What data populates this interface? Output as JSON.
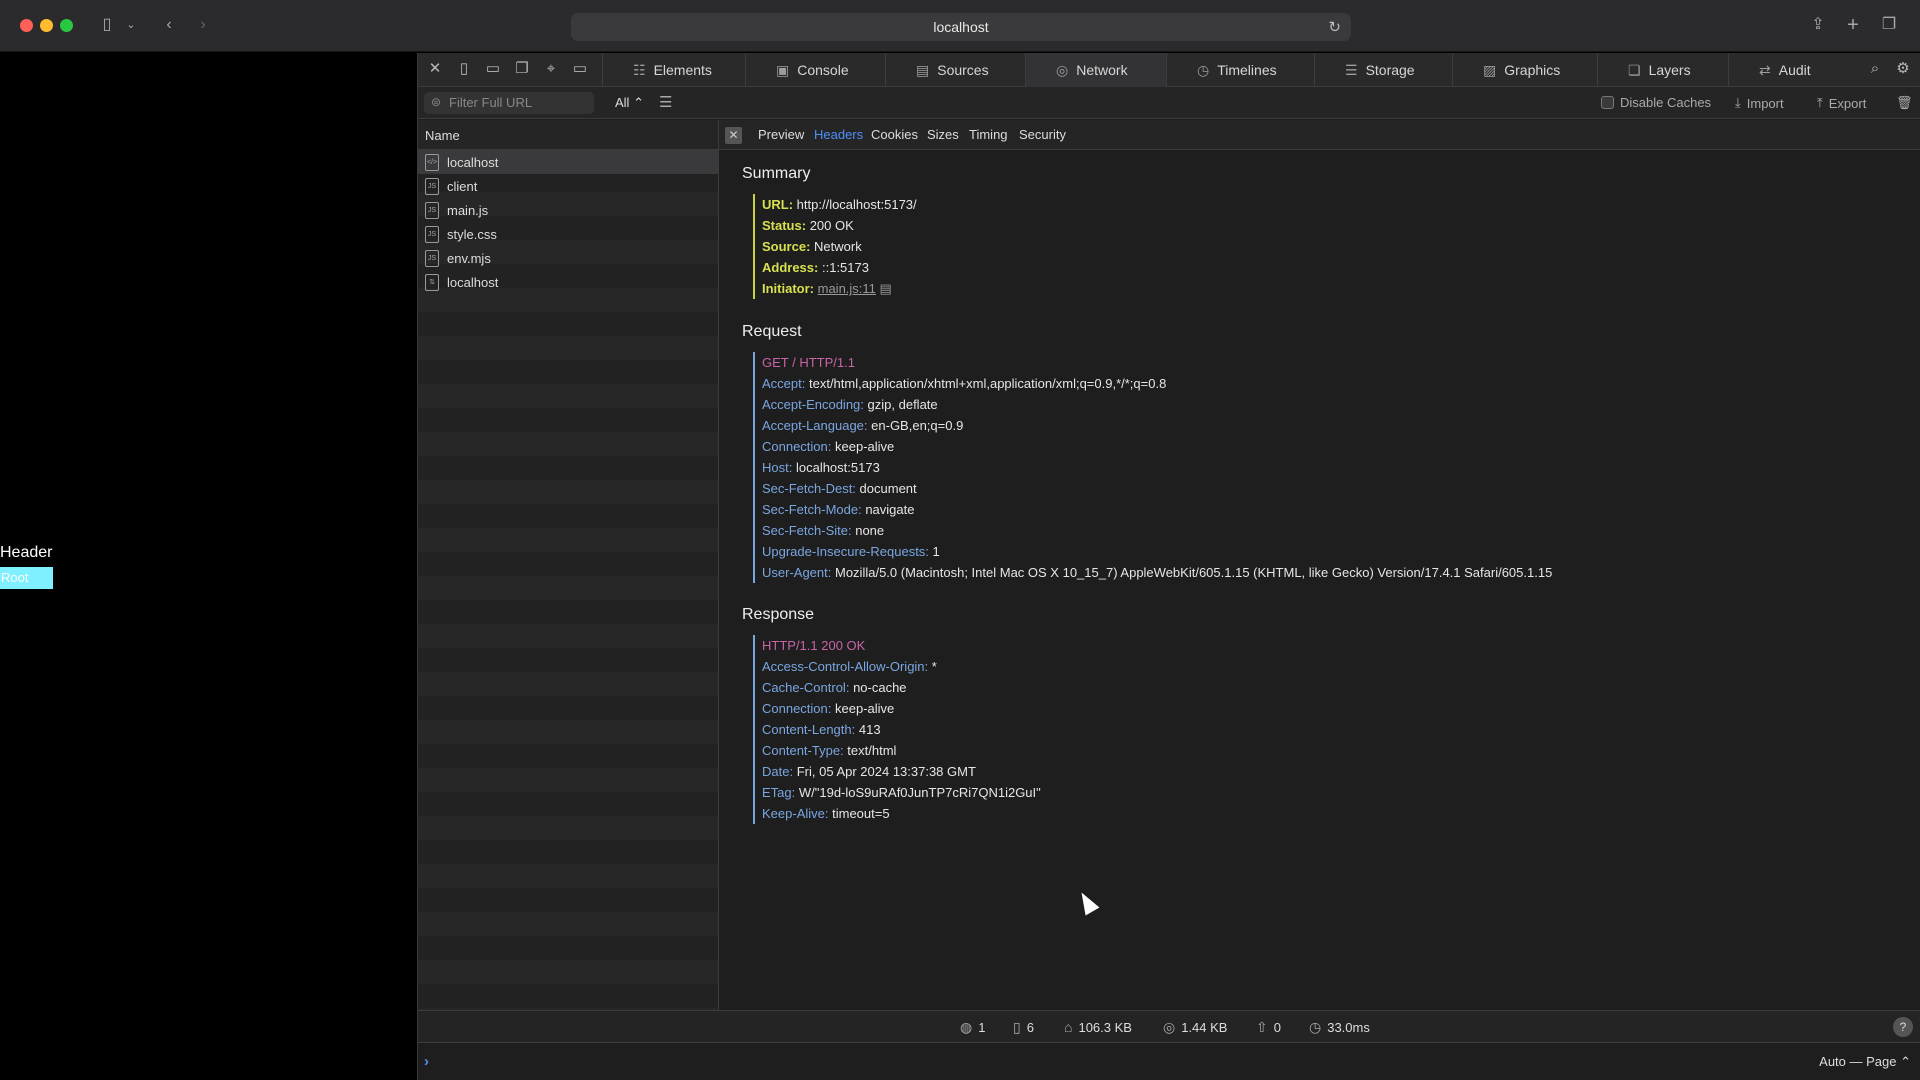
{
  "browser": {
    "url": "localhost"
  },
  "page": {
    "header_text": "Header",
    "root_text": "Root"
  },
  "devtools": {
    "tabs": [
      {
        "label": "Elements",
        "icon": "elements-icon"
      },
      {
        "label": "Console",
        "icon": "console-icon"
      },
      {
        "label": "Sources",
        "icon": "sources-icon"
      },
      {
        "label": "Network",
        "icon": "network-icon"
      },
      {
        "label": "Timelines",
        "icon": "timelines-icon"
      },
      {
        "label": "Storage",
        "icon": "storage-icon"
      },
      {
        "label": "Graphics",
        "icon": "graphics-icon"
      },
      {
        "label": "Layers",
        "icon": "layers-icon"
      },
      {
        "label": "Audit",
        "icon": "audit-icon"
      }
    ],
    "active_tab": "Network",
    "filter": {
      "placeholder": "Filter Full URL",
      "type_select": "All",
      "disable_caches": "Disable Caches",
      "import": "Import",
      "export": "Export"
    },
    "list": {
      "column_name": "Name",
      "rows": [
        {
          "name": "localhost",
          "icon": "html-file-icon"
        },
        {
          "name": "client",
          "icon": "js-file-icon"
        },
        {
          "name": "main.js",
          "icon": "js-file-icon"
        },
        {
          "name": "style.css",
          "icon": "css-file-icon"
        },
        {
          "name": "env.mjs",
          "icon": "js-file-icon"
        },
        {
          "name": "localhost",
          "icon": "websocket-file-icon"
        }
      ]
    },
    "detail_tabs": [
      "Preview",
      "Headers",
      "Cookies",
      "Sizes",
      "Timing",
      "Security"
    ],
    "active_detail_tab": "Headers",
    "summary": {
      "title": "Summary",
      "url_k": "URL:",
      "url_v": "http://localhost:5173/",
      "status_k": "Status:",
      "status_v": "200 OK",
      "source_k": "Source:",
      "source_v": "Network",
      "address_k": "Address:",
      "address_v": "::1:5173",
      "initiator_k": "Initiator:",
      "initiator_v": "main.js:11"
    },
    "request": {
      "title": "Request",
      "first_line": "GET / HTTP/1.1",
      "headers": [
        {
          "k": "Accept:",
          "v": "text/html,application/xhtml+xml,application/xml;q=0.9,*/*;q=0.8"
        },
        {
          "k": "Accept-Encoding:",
          "v": "gzip, deflate"
        },
        {
          "k": "Accept-Language:",
          "v": "en-GB,en;q=0.9"
        },
        {
          "k": "Connection:",
          "v": "keep-alive"
        },
        {
          "k": "Host:",
          "v": "localhost:5173"
        },
        {
          "k": "Sec-Fetch-Dest:",
          "v": "document"
        },
        {
          "k": "Sec-Fetch-Mode:",
          "v": "navigate"
        },
        {
          "k": "Sec-Fetch-Site:",
          "v": "none"
        },
        {
          "k": "Upgrade-Insecure-Requests:",
          "v": "1"
        },
        {
          "k": "User-Agent:",
          "v": "Mozilla/5.0 (Macintosh; Intel Mac OS X 10_15_7) AppleWebKit/605.1.15 (KHTML, like Gecko) Version/17.4.1 Safari/605.1.15"
        }
      ]
    },
    "response": {
      "title": "Response",
      "first_line": "HTTP/1.1 200 OK",
      "headers": [
        {
          "k": "Access-Control-Allow-Origin:",
          "v": "*"
        },
        {
          "k": "Cache-Control:",
          "v": "no-cache"
        },
        {
          "k": "Connection:",
          "v": "keep-alive"
        },
        {
          "k": "Content-Length:",
          "v": "413"
        },
        {
          "k": "Content-Type:",
          "v": "text/html"
        },
        {
          "k": "Date:",
          "v": "Fri, 05 Apr 2024 13:37:38 GMT"
        },
        {
          "k": "ETag:",
          "v": "W/\"19d-loS9uRAf0JunTP7cRi7QN1i2GuI\""
        },
        {
          "k": "Keep-Alive:",
          "v": "timeout=5"
        }
      ]
    },
    "stats": {
      "domains": "1",
      "resources": "6",
      "resources_size": "106.3 KB",
      "transferred": "1.44 KB",
      "redirects": "0",
      "load_time": "33.0ms"
    },
    "console": {
      "page_mode": "Auto — Page"
    }
  },
  "colors": {
    "accent": "#4d8ef7",
    "summary_key": "#d7e04f",
    "header_key": "#7aa6e0",
    "first_line": "#c865a8",
    "root_bg": "#7ff0ff"
  }
}
